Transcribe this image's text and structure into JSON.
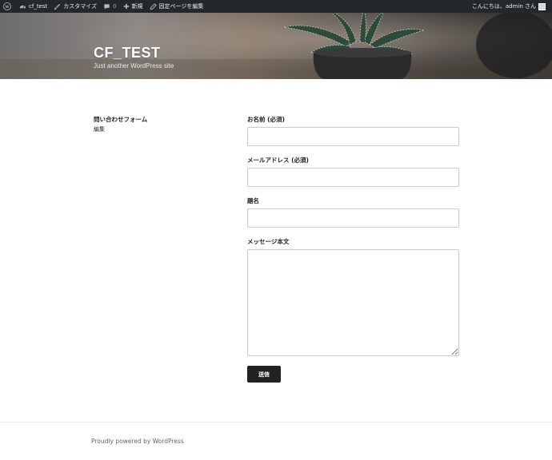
{
  "admin_bar": {
    "site_name": "cf_test",
    "customize_label": "カスタマイズ",
    "comments_count": "0",
    "new_label": "新規",
    "edit_page_label": "固定ページを編集",
    "greeting": "こんにちは、admin さん",
    "bg_color": "#23282d"
  },
  "header": {
    "site_title": "CF_TEST",
    "tagline": "Just another WordPress site"
  },
  "entry": {
    "title": "問い合わせフォーム",
    "edit_link": "編集"
  },
  "form": {
    "fields": [
      {
        "label": "お名前 (必須)",
        "value": ""
      },
      {
        "label": "メールアドレス (必須)",
        "value": ""
      },
      {
        "label": "題名",
        "value": ""
      }
    ],
    "message": {
      "label": "メッセージ本文",
      "value": ""
    },
    "submit_label": "送信"
  },
  "footer": {
    "credit": "Proudly powered by WordPress"
  }
}
